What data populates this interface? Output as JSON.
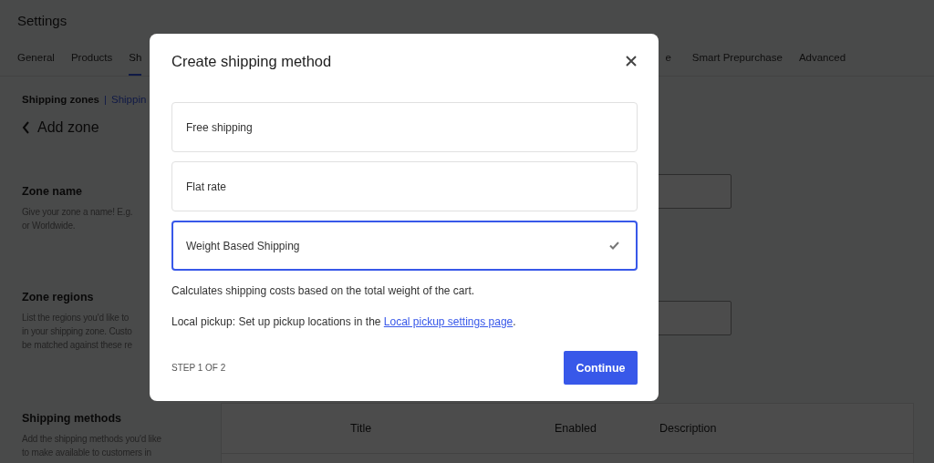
{
  "page": {
    "title": "Settings",
    "tabs": [
      {
        "label": "General",
        "selected": false
      },
      {
        "label": "Products",
        "selected": false
      },
      {
        "label": "Sh",
        "selected": true
      },
      {
        "label": "e",
        "selected": false
      },
      {
        "label": "Smart Prepurchase",
        "selected": false
      },
      {
        "label": "Advanced",
        "selected": false
      }
    ],
    "breadcrumb_separator": "|",
    "breadcrumb": [
      {
        "label": "Shipping zones",
        "selected": true
      },
      {
        "label": "Shippin",
        "selected": false
      }
    ],
    "back_title": "Add zone",
    "sections": [
      {
        "kind": "field",
        "title": "Zone name",
        "lines": [
          "Give your zone a name! E.g.",
          "or Worldwide."
        ]
      },
      {
        "kind": "field",
        "title": "Zone regions",
        "lines": [
          "List the regions you'd like to",
          "in your shipping zone. Custo",
          "be matched against these re"
        ]
      },
      {
        "kind": "table",
        "title": "Shipping methods",
        "lines": [
          "Add the shipping methods you'd like",
          "to make available to customers in"
        ],
        "columns": [
          "Title",
          "Enabled",
          "Description"
        ]
      }
    ]
  },
  "modal": {
    "title": "Create shipping method",
    "options": [
      {
        "label": "Free shipping",
        "selected": false
      },
      {
        "label": "Flat rate",
        "selected": false
      },
      {
        "label": "Weight Based Shipping",
        "selected": true
      }
    ],
    "description": "Calculates shipping costs based on the total weight of the cart.",
    "pickup_note": {
      "text": "Local pickup: Set up pickup locations in the ",
      "link": "Local pickup settings page",
      "suffix": "."
    },
    "step": "STEP 1 OF 2",
    "button": "Continue"
  }
}
